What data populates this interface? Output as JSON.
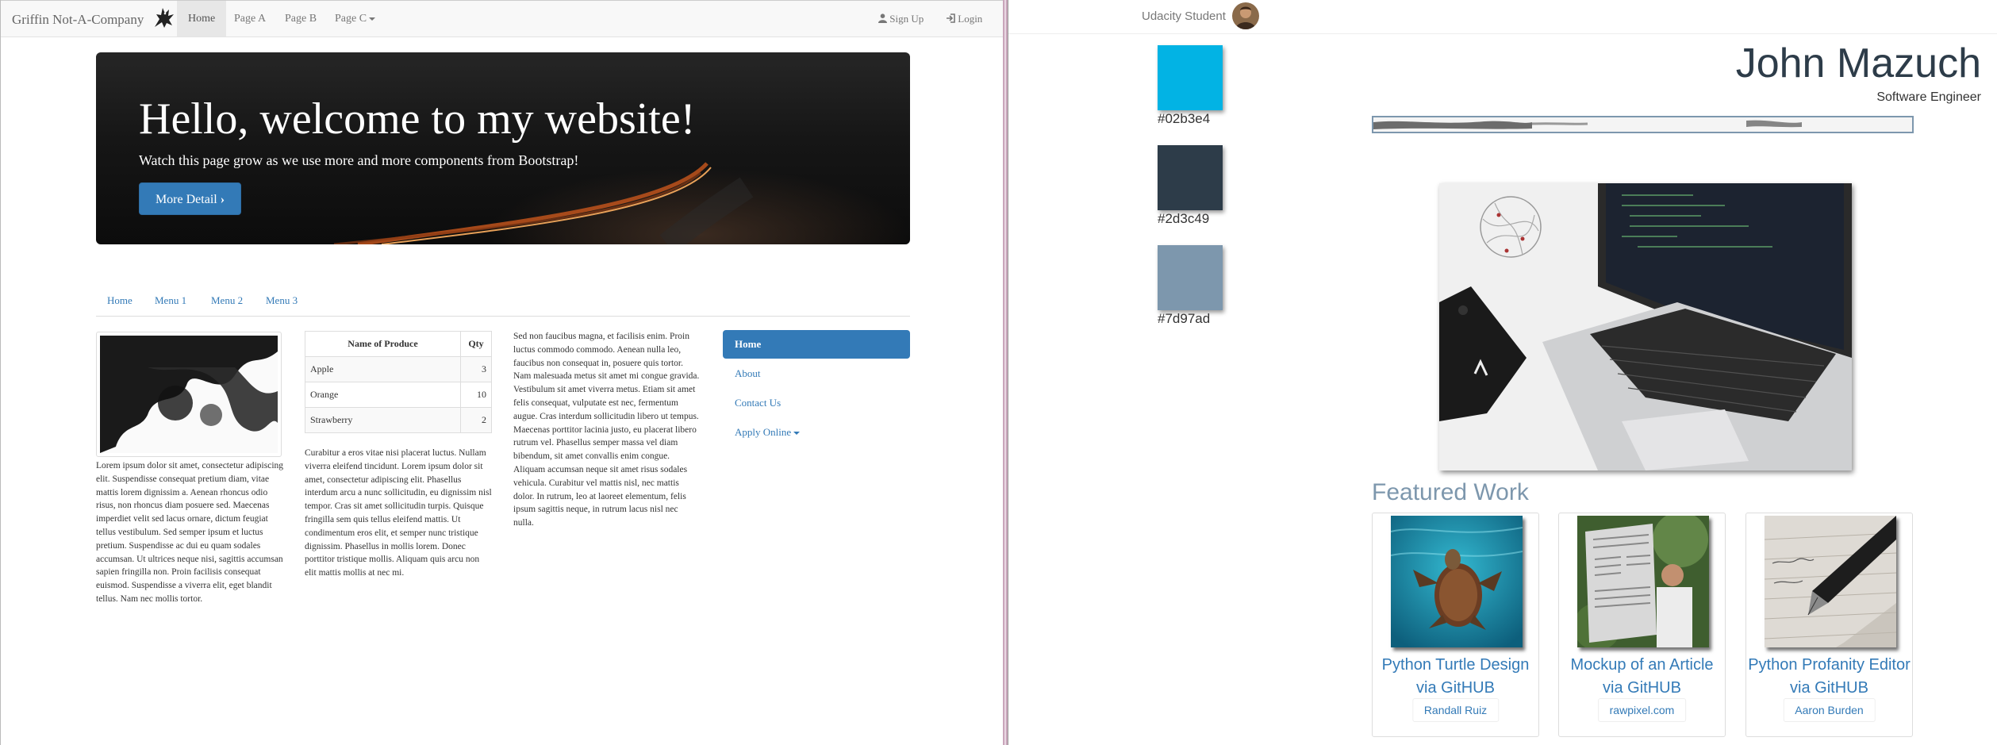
{
  "left_site": {
    "navbar": {
      "brand": "Griffin Not-A-Company",
      "items": [
        "Home",
        "Page A",
        "Page B",
        "Page C"
      ],
      "active": "Home",
      "signup": "Sign Up",
      "login": "Login"
    },
    "hero": {
      "title": "Hello, welcome to my website!",
      "subtitle": "Watch this page grow as we use more and more components from Bootstrap!",
      "button": "More Detail"
    },
    "subnav": [
      "Home",
      "Menu 1",
      "Menu 2",
      "Menu 3"
    ],
    "col1_text": "Lorem ipsum dolor sit amet, consectetur adipiscing elit. Suspendisse consequat pretium diam, vitae mattis lorem dignissim a. Aenean rhoncus odio risus, non rhoncus diam posuere sed. Maecenas imperdiet velit sed lacus ornare, dictum feugiat tellus vestibulum. Sed semper ipsum et luctus pretium. Suspendisse ac dui eu quam sodales accumsan. Ut ultrices neque nisi, sagittis accumsan sapien fringilla non. Proin facilisis consequat euismod. Suspendisse a viverra elit, eget blandit tellus. Nam nec mollis tortor.",
    "table": {
      "headers": [
        "Name of Produce",
        "Qty"
      ],
      "rows": [
        [
          "Apple",
          "3"
        ],
        [
          "Orange",
          "10"
        ],
        [
          "Strawberry",
          "2"
        ]
      ]
    },
    "col2_text": "Curabitur a eros vitae nisi placerat luctus. Nullam viverra eleifend tincidunt. Lorem ipsum dolor sit amet, consectetur adipiscing elit. Phasellus interdum arcu a nunc sollicitudin, eu dignissim nisl tempor. Cras sit amet sollicitudin turpis. Quisque fringilla sem quis tellus eleifend mattis. Ut condimentum eros elit, et semper nunc tristique dignissim. Phasellus in mollis lorem. Donec porttitor tristique mollis. Aliquam quis arcu non elit mattis mollis at nec mi.",
    "col3_text": "Sed non faucibus magna, et facilisis enim. Proin luctus commodo commodo. Aenean nulla leo, faucibus non consequat in, posuere quis tortor. Nam malesuada metus sit amet mi congue gravida. Vestibulum sit amet viverra metus. Etiam sit amet felis consequat, vulputate est nec, fermentum augue. Cras interdum sollicitudin libero ut tempus. Maecenas porttitor lacinia justo, eu placerat libero rutrum vel. Phasellus semper massa vel diam bibendum, sit amet convallis enim congue. Aliquam accumsan neque sit amet risus sodales vehicula. Curabitur vel mattis nisl, nec mattis dolor. In rutrum, leo at laoreet elementum, felis ipsum sagittis neque, in rutrum lacus nisl nec nulla.",
    "vnav": [
      "Home",
      "About",
      "Contact Us",
      "Apply Online"
    ]
  },
  "right_site": {
    "topbar": {
      "user": "Udacity Student"
    },
    "swatches": [
      {
        "color": "#02b3e4",
        "label": "#02b3e4"
      },
      {
        "color": "#2d3c49",
        "label": "#2d3c49"
      },
      {
        "color": "#7d97ad",
        "label": "#7d97ad"
      }
    ],
    "name": "John Mazuch",
    "role": "Software Engineer",
    "featured_heading": "Featured Work",
    "cards": [
      {
        "title": "Python Turtle Design via GitHUB",
        "credit": "Randall Ruiz"
      },
      {
        "title": "Mockup of an Article via GitHUB",
        "credit": "rawpixel.com"
      },
      {
        "title": "Python Profanity Editor via GitHUB",
        "credit": "Aaron Burden"
      }
    ]
  }
}
